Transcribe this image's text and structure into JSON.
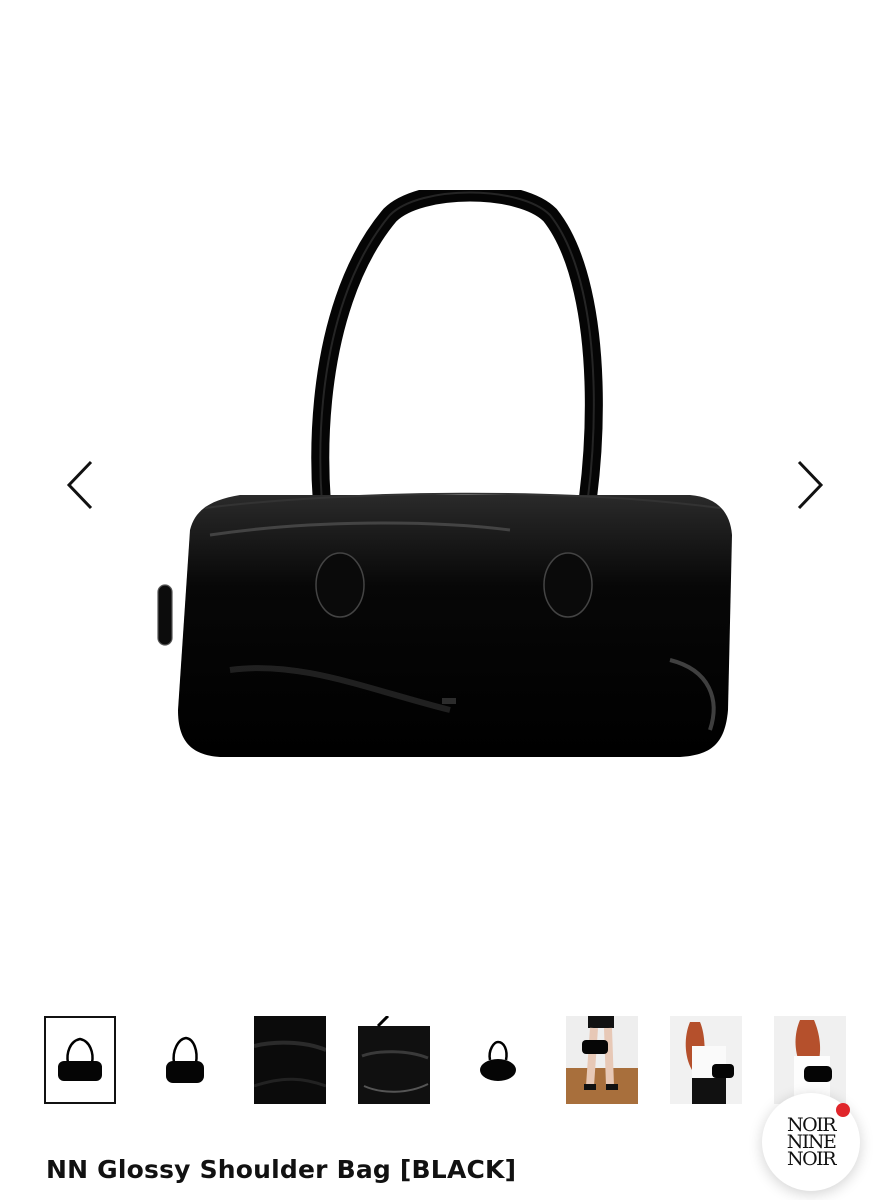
{
  "product": {
    "title": "NN Glossy Shoulder Bag [BLACK]"
  },
  "gallery": {
    "prev_icon": "chevron-left-icon",
    "next_icon": "chevron-right-icon",
    "thumbnails": [
      {
        "name": "thumb-bag-front",
        "selected": true
      },
      {
        "name": "thumb-bag-angle",
        "selected": false
      },
      {
        "name": "thumb-bag-closeup",
        "selected": false
      },
      {
        "name": "thumb-bag-interior",
        "selected": false
      },
      {
        "name": "thumb-bag-mini",
        "selected": false
      },
      {
        "name": "thumb-model-legs",
        "selected": false
      },
      {
        "name": "thumb-model-shoulder",
        "selected": false
      },
      {
        "name": "thumb-model-carry",
        "selected": false
      }
    ]
  },
  "brand_badge": {
    "line1": "NOIR",
    "line2": "NINE",
    "line3": "NOIR",
    "dot_color": "#e0262b"
  },
  "colors": {
    "background": "#ffffff",
    "bag": "#050505",
    "text": "#111111"
  }
}
